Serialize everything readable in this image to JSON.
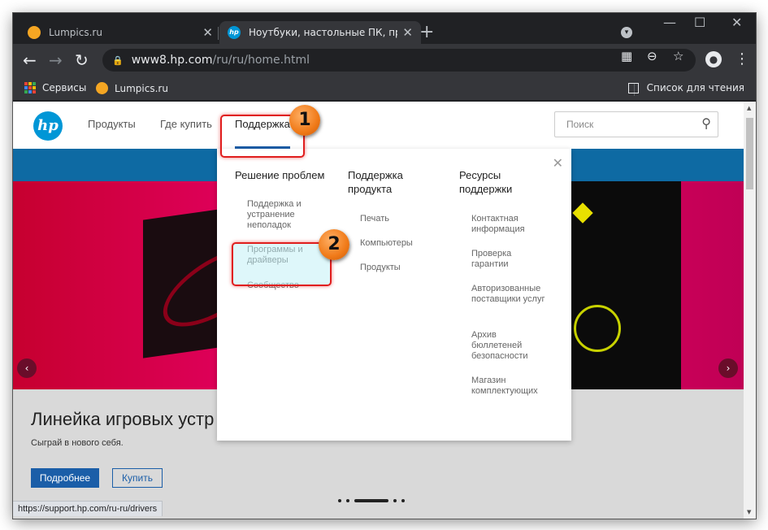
{
  "tabs": [
    {
      "title": "Lumpics.ru",
      "favicon_color": "#f5a623",
      "active": false
    },
    {
      "title": "Ноутбуки, настольные ПК, при",
      "favicon_color": "#0096d6",
      "active": true
    }
  ],
  "toolbar": {
    "url_host": "www8.hp.com",
    "url_path": "/ru/ru/home.html"
  },
  "bookmarks": {
    "items": [
      {
        "label": "Сервисы"
      },
      {
        "label": "Lumpics.ru"
      }
    ],
    "reading_list": "Список для чтения"
  },
  "hp": {
    "logo_text": "hp",
    "nav": [
      "Продукты",
      "Где купить",
      "Поддержка"
    ],
    "search_placeholder": "Поиск",
    "dropdown": {
      "columns": [
        {
          "heading": "Решение проблем",
          "items": [
            "Поддержка и устранение неполадок",
            "Программы и драйверы",
            "Сообщество"
          ]
        },
        {
          "heading": "Поддержка продукта",
          "items": [
            "Печать",
            "Компьютеры",
            "Продукты"
          ]
        },
        {
          "heading": "Ресурсы поддержки",
          "items": [
            "Контактная информация",
            "Проверка гарантии",
            "Авторизованные поставщики услуг",
            "Архив бюллетеней безопасности",
            "Магазин комплектующих"
          ]
        }
      ]
    },
    "hero": {
      "title": "Линейка игровых устр",
      "subtitle": "Сыграй в нового себя.",
      "more_button": "Подробнее",
      "buy_button": "Купить"
    }
  },
  "status_url": "https://support.hp.com/ru-ru/drivers",
  "callouts": [
    "1",
    "2"
  ],
  "colors": {
    "hp_blue": "#0096d6",
    "brand_blue": "#1b5ea8",
    "highlight_red": "#e01e1e",
    "callout_orange": "#f07a18"
  }
}
